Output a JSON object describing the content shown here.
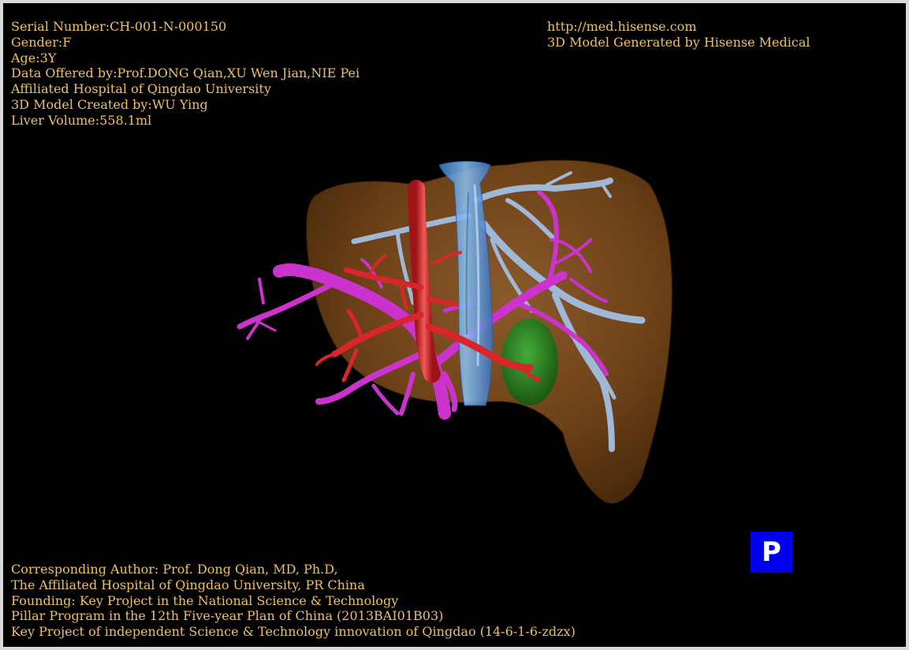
{
  "header_left": {
    "serial": "Serial Number:CH-001-N-000150",
    "gender": "Gender:F",
    "age": "Age:3Y",
    "data_offered": "Data Offered by:Prof.DONG Qian,XU Wen Jian,NIE Pei",
    "hospital": "Affiliated Hospital of Qingdao University",
    "model_created": "3D Model Created by:WU Ying",
    "liver_volume": "Liver Volume:558.1ml"
  },
  "header_right": {
    "url": "http://med.hisense.com",
    "generated_by": "3D Model Generated by Hisense Medical"
  },
  "footer": {
    "line1": "Corresponding Author: Prof. Dong Qian, MD, Ph.D,",
    "line2": "The Affiliated Hospital of Qingdao University, PR China",
    "line3": "Founding: Key Project in the National Science & Technology",
    "line4": "Pillar Program in the 12th Five-year Plan of China (2013BAI01B03)",
    "line5": "Key Project of independent Science & Technology innovation of Qingdao (14-6-1-6-zdzx)"
  },
  "view_button": {
    "label": "P"
  },
  "colors": {
    "text": "#f0c060",
    "liver": "#7a4a1e",
    "hepatic_artery": "#d8262a",
    "portal_vein": "#cc33cc",
    "inferior_vena_cava": "#6aa8e8",
    "hepatic_veins": "#9fb8d8",
    "lesion": "#1f8a1f",
    "view_button": "#0000ee"
  }
}
